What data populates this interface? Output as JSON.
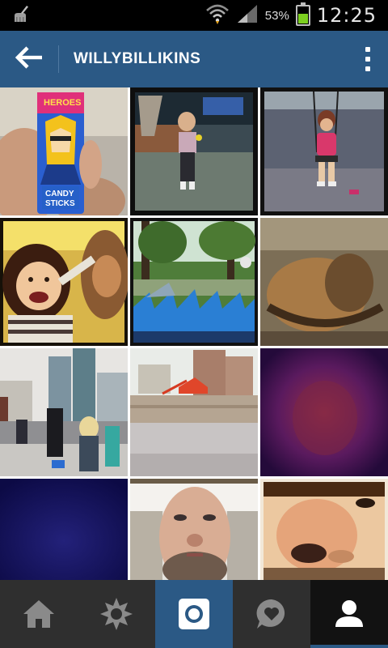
{
  "status_bar": {
    "battery_percent": "53%",
    "time": "12:25",
    "icons": [
      "cleaner-icon",
      "wifi-icon",
      "signal-icon",
      "battery-icon"
    ],
    "battery_level": 0.53
  },
  "app_bar": {
    "title": "WILLYBILLIKINS",
    "back_icon": "arrow-left-icon",
    "menu_icon": "more-vertical-icon",
    "color": "#2b5985"
  },
  "grid": {
    "photos": [
      {
        "name": "photo-candy-sticks",
        "caption_lines": [
          "HEROES",
          "CANDY",
          "STICKS"
        ]
      },
      {
        "name": "photo-girl-street"
      },
      {
        "name": "photo-girl-swing"
      },
      {
        "name": "photo-selfie-child"
      },
      {
        "name": "photo-shark-ride"
      },
      {
        "name": "photo-hat-closeup"
      },
      {
        "name": "photo-city-crowd"
      },
      {
        "name": "photo-demolition-site"
      },
      {
        "name": "photo-dark-purple"
      },
      {
        "name": "photo-dark-blue"
      },
      {
        "name": "photo-man-face"
      },
      {
        "name": "photo-nose-closeup"
      }
    ]
  },
  "bottom_nav": {
    "items": [
      {
        "name": "home",
        "icon": "home-icon"
      },
      {
        "name": "explore",
        "icon": "star-icon"
      },
      {
        "name": "camera",
        "icon": "camera-icon"
      },
      {
        "name": "activity",
        "icon": "heart-bubble-icon"
      },
      {
        "name": "profile",
        "icon": "person-icon"
      }
    ],
    "active": "profile",
    "accent": "#2b5985"
  }
}
